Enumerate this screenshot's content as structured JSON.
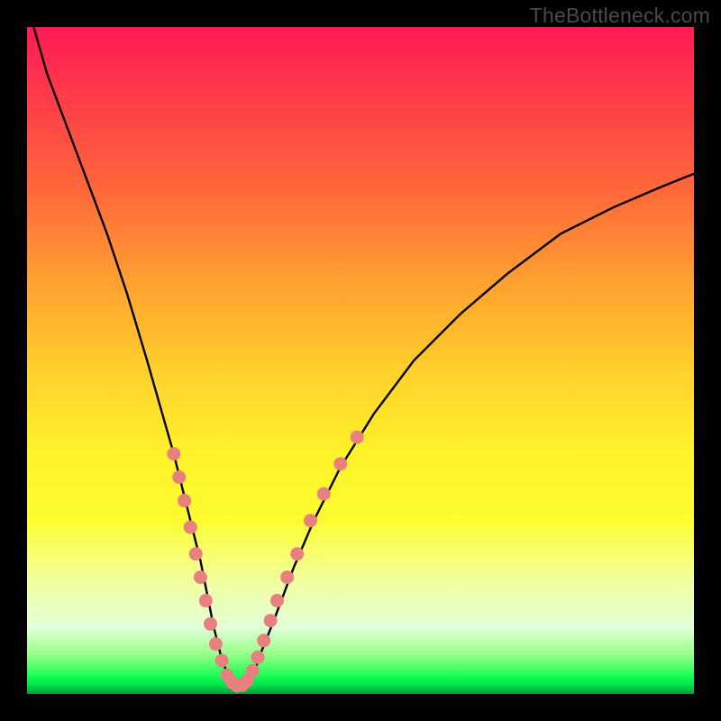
{
  "watermark": "TheBottleneck.com",
  "chart_data": {
    "type": "line",
    "title": "",
    "xlabel": "",
    "ylabel": "",
    "xlim": [
      0,
      100
    ],
    "ylim": [
      0,
      100
    ],
    "grid": false,
    "legend": false,
    "series": [
      {
        "name": "bottleneck-curve",
        "color": "#000000",
        "x": [
          1,
          3,
          6,
          9,
          12,
          15,
          18,
          20,
          22,
          24,
          25,
          26,
          27,
          28,
          29,
          30,
          31,
          32,
          33,
          34,
          35,
          37,
          40,
          43,
          47,
          52,
          58,
          65,
          72,
          80,
          88,
          95,
          100
        ],
        "y": [
          100,
          93,
          85,
          77,
          69,
          60,
          50,
          43,
          36,
          28,
          24,
          20,
          15,
          10,
          6,
          3,
          1.5,
          1,
          1.5,
          3,
          6,
          11,
          19,
          26,
          34,
          42,
          50,
          57,
          63,
          69,
          73,
          76,
          78
        ]
      }
    ],
    "scatter_overlay": {
      "name": "highlight-dots",
      "color": "#e98080",
      "points": [
        [
          22.0,
          36.0
        ],
        [
          22.8,
          32.5
        ],
        [
          23.6,
          29.0
        ],
        [
          24.5,
          25.0
        ],
        [
          25.3,
          21.0
        ],
        [
          26.0,
          17.5
        ],
        [
          26.8,
          14.0
        ],
        [
          27.5,
          10.5
        ],
        [
          28.3,
          7.5
        ],
        [
          29.2,
          5.0
        ],
        [
          30.0,
          2.8
        ],
        [
          30.8,
          1.7
        ],
        [
          31.5,
          1.2
        ],
        [
          32.3,
          1.3
        ],
        [
          33.0,
          2.0
        ],
        [
          33.8,
          3.5
        ],
        [
          34.6,
          5.5
        ],
        [
          35.5,
          8.0
        ],
        [
          36.5,
          11.0
        ],
        [
          37.5,
          14.0
        ],
        [
          39.0,
          17.5
        ],
        [
          40.5,
          21.0
        ],
        [
          42.5,
          26.0
        ],
        [
          44.5,
          30.0
        ],
        [
          47.0,
          34.5
        ],
        [
          49.5,
          38.5
        ]
      ]
    }
  }
}
